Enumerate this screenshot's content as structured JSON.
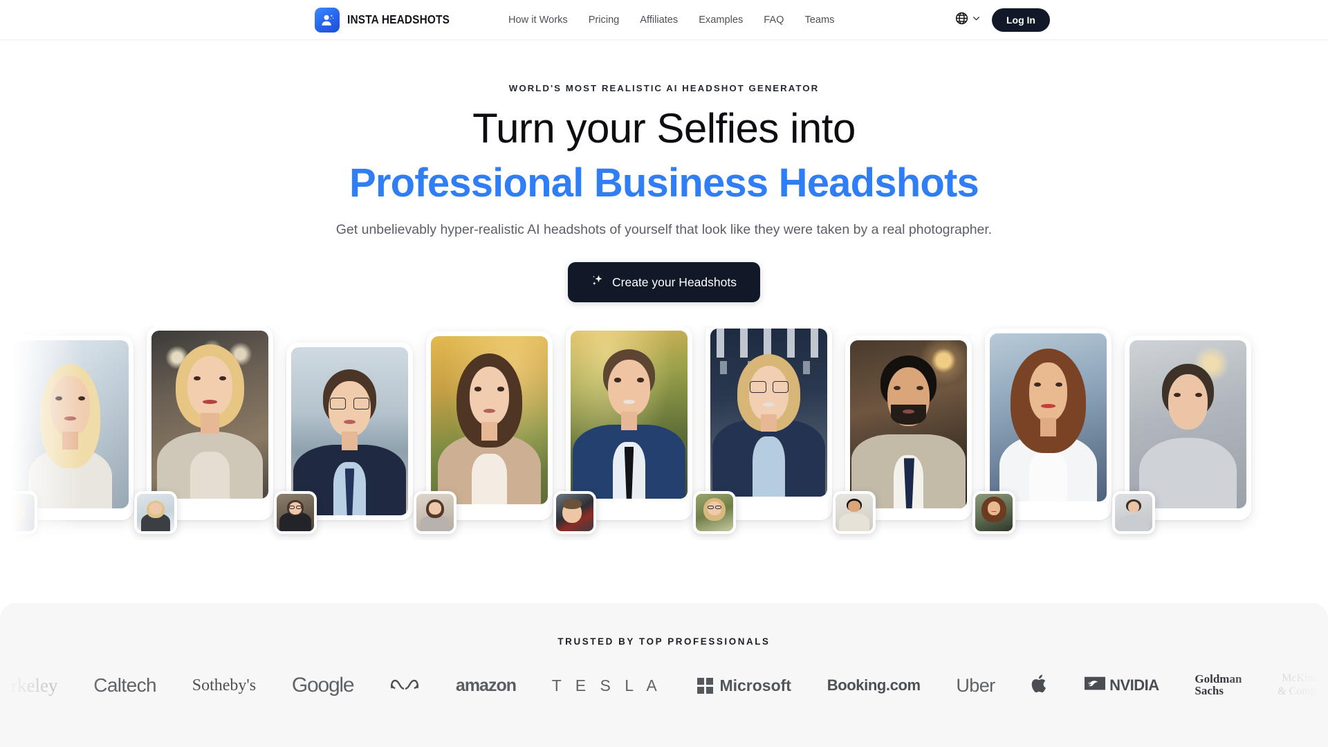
{
  "header": {
    "brand_name": "INSTA HEADSHOTS",
    "brand_icon": "person-avatar-icon",
    "nav": [
      {
        "label": "How it Works"
      },
      {
        "label": "Pricing"
      },
      {
        "label": "Affiliates"
      },
      {
        "label": "Examples"
      },
      {
        "label": "FAQ"
      },
      {
        "label": "Teams"
      }
    ],
    "language_icon": "globe-icon",
    "language_chevron_icon": "chevron-down-icon",
    "login_label": "Log In"
  },
  "hero": {
    "eyebrow": "WORLD'S MOST REALISTIC AI HEADSHOT GENERATOR",
    "headline_line1": "Turn your Selfies into",
    "headline_line2": "Professional Business Headshots",
    "subhead": "Get unbelievably hyper-realistic AI headshots of yourself that look like they were taken by a real photographer.",
    "cta_label": "Create your Headshots",
    "cta_icon": "sparkles-icon",
    "accent_color": "#2F7EF5",
    "cta_bg_color": "#111827"
  },
  "gallery": {
    "items": [
      {
        "name": "blonde-woman-window",
        "after_alt": "Blonde woman professional headshot by window",
        "before_alt": "Selfie of blonde woman"
      },
      {
        "name": "blonde-bob-woman-office",
        "after_alt": "Blonde bob woman in beige sweater, office",
        "before_alt": "Outdoor snow selfie"
      },
      {
        "name": "man-glasses-beach",
        "after_alt": "Man with glasses in navy suit by the sea",
        "before_alt": "Selfie of man with glasses indoors"
      },
      {
        "name": "brunette-woman-park",
        "after_alt": "Brunette woman in tan blazer, autumn park",
        "before_alt": "Indoor selfie of brunette woman"
      },
      {
        "name": "man-navy-suit-park",
        "after_alt": "Man in navy suit and black tie, autumn park",
        "before_alt": "Car selfie of smiling man"
      },
      {
        "name": "woman-glasses-office",
        "after_alt": "Blonde woman with glasses in navy blazer, office",
        "before_alt": "Outdoor selfie of woman with glasses"
      },
      {
        "name": "bearded-man-tan-suit",
        "after_alt": "Bearded man in tan suit with navy tie",
        "before_alt": "Selfie of bearded man in cream shirt"
      },
      {
        "name": "woman-white-shirt-city",
        "after_alt": "Woman with wavy hair in white shirt, city backdrop",
        "before_alt": "Selfie of woman with long hair"
      },
      {
        "name": "man-grey-shirt-edge",
        "after_alt": "Man in grey shirt, partially visible",
        "before_alt": "Selfie of man in grey shirt"
      }
    ]
  },
  "trusted": {
    "title": "TRUSTED BY TOP PROFESSIONALS",
    "logos": [
      {
        "name": "berkeley",
        "label": "Berkeley",
        "style": "l-berkeley"
      },
      {
        "name": "caltech",
        "label": "Caltech",
        "style": "l-caltech"
      },
      {
        "name": "sothebys",
        "label": "Sotheby's",
        "style": "l-sothebys"
      },
      {
        "name": "google",
        "label": "Google",
        "style": "l-google"
      },
      {
        "name": "meta",
        "label": "",
        "style": "l-meta"
      },
      {
        "name": "amazon",
        "label": "amazon",
        "style": "l-amazon"
      },
      {
        "name": "tesla",
        "label": "T E S L A",
        "style": "l-tesla"
      },
      {
        "name": "microsoft",
        "label": "Microsoft",
        "style": "l-microsoft"
      },
      {
        "name": "booking-com",
        "label": "Booking.com",
        "style": "l-booking"
      },
      {
        "name": "uber",
        "label": "Uber",
        "style": "l-uber"
      },
      {
        "name": "apple",
        "label": "",
        "style": "l-apple"
      },
      {
        "name": "nvidia",
        "label": "NVIDIA",
        "style": "l-nvidia"
      },
      {
        "name": "goldman-sachs",
        "label": "Goldman Sachs",
        "style": "l-goldman"
      },
      {
        "name": "mckinsey",
        "label": "McKinsey & Company",
        "style": "l-mckinsey"
      }
    ]
  }
}
